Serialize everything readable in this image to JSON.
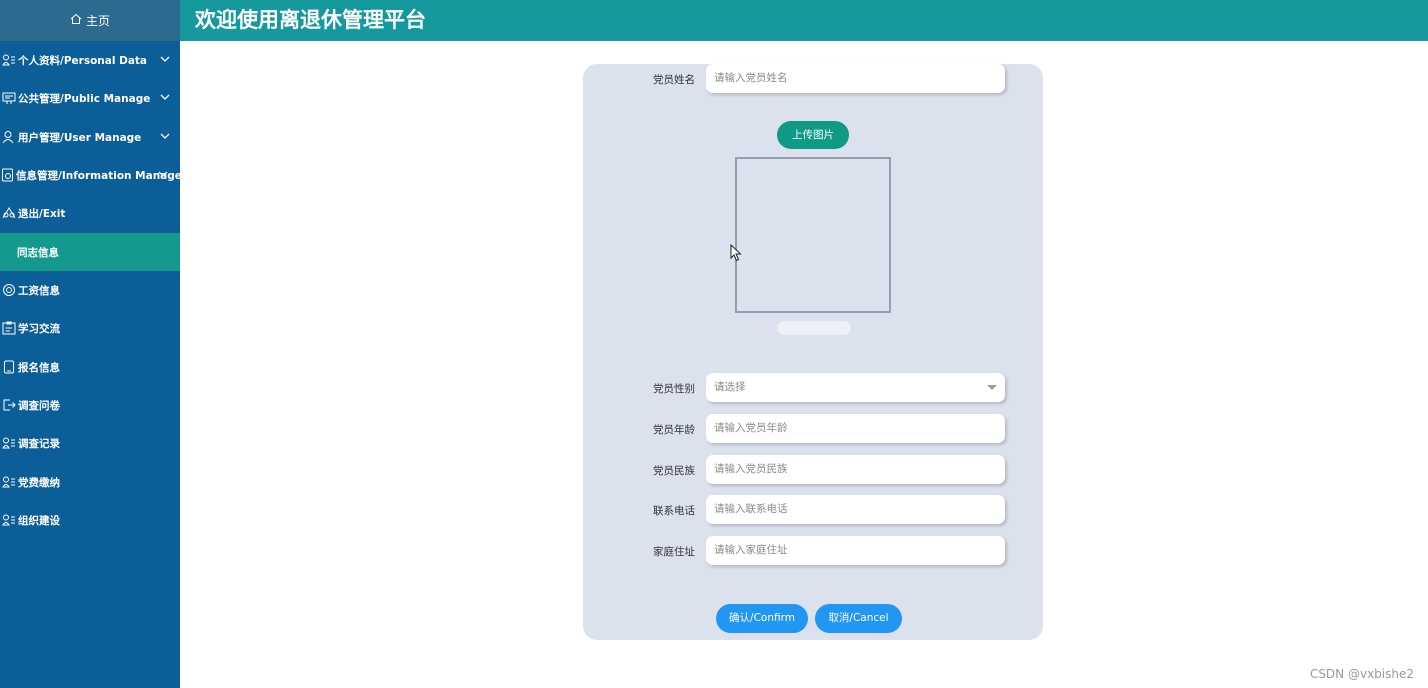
{
  "sidebar": {
    "home_label": "主页",
    "items": [
      {
        "label": "个人资料/Personal Data",
        "icon": "person-card-icon"
      },
      {
        "label": "公共管理/Public Manage",
        "icon": "board-icon"
      },
      {
        "label": "用户管理/User Manage",
        "icon": "user-icon"
      },
      {
        "label": "信息管理/Information Manage",
        "icon": "doc-gear-icon"
      },
      {
        "label": "退出/Exit",
        "icon": "exit-icon"
      },
      {
        "label": "同志信息",
        "icon": ""
      },
      {
        "label": "工资信息",
        "icon": "coin-icon"
      },
      {
        "label": "学习交流",
        "icon": "clipboard-icon"
      },
      {
        "label": "报名信息",
        "icon": "phone-icon"
      },
      {
        "label": "调查问卷",
        "icon": "logout-box-icon"
      },
      {
        "label": "调查记录",
        "icon": "person-card-icon"
      },
      {
        "label": "党费缴纳",
        "icon": "person-card-icon"
      },
      {
        "label": "组织建设",
        "icon": "person-card-icon"
      }
    ]
  },
  "header": {
    "title": "欢迎使用离退休管理平台"
  },
  "form": {
    "name_label": "党员姓名",
    "name_placeholder": "请输入党员姓名",
    "upload_label": "上传图片",
    "gender_label": "党员性别",
    "gender_placeholder": "请选择",
    "age_label": "党员年龄",
    "age_placeholder": "请输入党员年龄",
    "ethnicity_label": "党员民族",
    "ethnicity_placeholder": "请输入党员民族",
    "phone_label": "联系电话",
    "phone_placeholder": "请输入联系电话",
    "address_label": "家庭住址",
    "address_placeholder": "请输入家庭住址",
    "confirm_label": "确认/Confirm",
    "cancel_label": "取消/Cancel"
  },
  "watermark": "CSDN @vxbishe2",
  "colors": {
    "sidebar": "#0b5e97",
    "header": "#15999c",
    "active_item": "#15998e",
    "panel": "#dce1ee",
    "primary_button": "#2196f3",
    "upload_button": "#0f9a86"
  }
}
